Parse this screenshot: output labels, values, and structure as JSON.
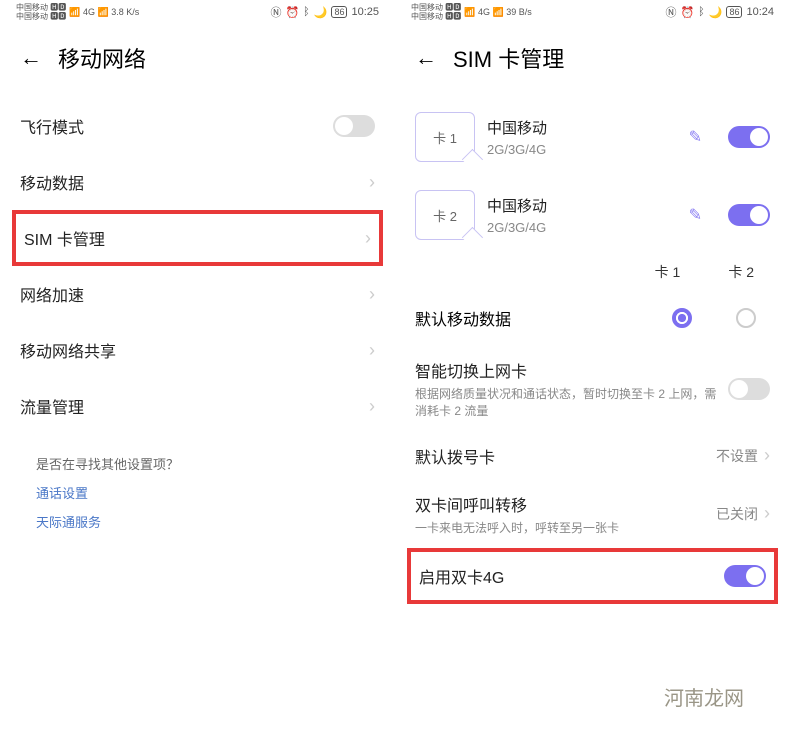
{
  "phone1": {
    "status": {
      "carrier": "中国移动",
      "signal": "4G",
      "speed": "3.8 K/s",
      "battery": "86",
      "time": "10:25"
    },
    "title": "移动网络",
    "airplane": "飞行模式",
    "items": [
      {
        "label": "移动数据"
      },
      {
        "label": "SIM 卡管理",
        "highlighted": true
      },
      {
        "label": "网络加速"
      },
      {
        "label": "移动网络共享"
      },
      {
        "label": "流量管理"
      }
    ],
    "hints": {
      "prompt": "是否在寻找其他设置项？",
      "link1": "通话设置",
      "link2": "天际通服务"
    }
  },
  "phone2": {
    "status": {
      "carrier": "中国移动",
      "signal": "4G",
      "speed": "39 B/s",
      "battery": "86",
      "time": "10:24"
    },
    "title": "SIM 卡管理",
    "sim1": {
      "slot": "卡 1",
      "name": "中国移动",
      "bands": "2G/3G/4G"
    },
    "sim2": {
      "slot": "卡 2",
      "name": "中国移动",
      "bands": "2G/3G/4G"
    },
    "radioHeader": {
      "c1": "卡 1",
      "c2": "卡 2"
    },
    "defaultData": "默认移动数据",
    "smartSwitch": {
      "title": "智能切换上网卡",
      "sub": "根据网络质量状况和通话状态，暂时切换至卡 2 上网，需消耗卡 2 流量"
    },
    "defaultDial": {
      "title": "默认拨号卡",
      "value": "不设置"
    },
    "callForward": {
      "title": "双卡间呼叫转移",
      "sub": "一卡来电无法呼入时，呼转至另一张卡",
      "value": "已关闭"
    },
    "dual4g": "启用双卡4G"
  },
  "watermark": "河南龙网"
}
